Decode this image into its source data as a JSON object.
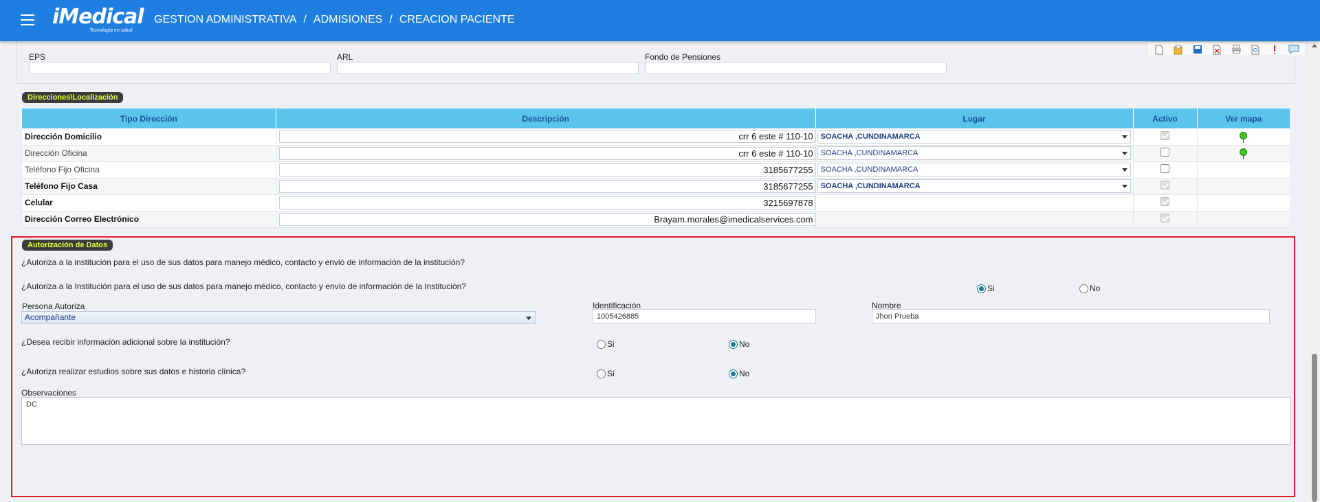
{
  "header": {
    "logo_text": "iMedical",
    "logo_tagline": "Tecnología en salud",
    "breadcrumb": [
      "GESTION ADMINISTRATIVA",
      "/",
      "ADMISIONES",
      "/",
      "CREACION PACIENTE"
    ]
  },
  "affiliation": {
    "eps_label": "EPS",
    "arl_label": "ARL",
    "pension_label": "Fondo de Pensiones",
    "eps_value": "",
    "arl_value": "",
    "pension_value": ""
  },
  "directions": {
    "section_title": "Direcciones\\Localización",
    "columns": [
      "Tipo Dirección",
      "Descripción",
      "Lugar",
      "Activo",
      "Ver mapa"
    ],
    "rows": [
      {
        "type": "Dirección Domicilio",
        "bold": true,
        "description": "crr 6 este # 110-10",
        "place": "SOACHA ,CUNDINAMARCA",
        "place_bold": true,
        "active": true,
        "active_disabled": true,
        "map": true
      },
      {
        "type": "Dirección Oficina",
        "bold": false,
        "description": "crr 6 este # 110-10",
        "place": "SOACHA ,CUNDINAMARCA",
        "place_bold": false,
        "active": false,
        "active_disabled": false,
        "map": true
      },
      {
        "type": "Teléfono Fijo Oficina",
        "bold": false,
        "description": "3185677255",
        "place": "SOACHA ,CUNDINAMARCA",
        "place_bold": false,
        "active": false,
        "active_disabled": false,
        "map": false
      },
      {
        "type": "Teléfono Fijo Casa",
        "bold": true,
        "description": "3185677255",
        "place": "SOACHA ,CUNDINAMARCA",
        "place_bold": true,
        "active": true,
        "active_disabled": true,
        "map": false
      },
      {
        "type": "Celular",
        "bold": true,
        "description": "3215697878",
        "place": "",
        "place_bold": false,
        "active": true,
        "active_disabled": true,
        "map": false
      },
      {
        "type": "Dirección Correo Electrónico",
        "bold": true,
        "description": "Brayam.morales@imedicalservices.com",
        "place": "",
        "place_bold": false,
        "active": true,
        "active_disabled": true,
        "map": false
      }
    ]
  },
  "authorization": {
    "section_title": "Autorización de Datos",
    "q1": "¿Autoriza a la institución para el uso de sus datos para manejo médico, contacto y envió de información de la institución?",
    "q2": "¿Autoriza a la Institución para el uso de sus datos para manejo médico, contacto y envío de información de la Institución?",
    "q2_yes": "Si",
    "q2_no": "No",
    "q2_value": "Si",
    "persona_label": "Persona Autoriza",
    "persona_value": "Acompañante",
    "identificacion_label": "Identificación",
    "identificacion_value": "1005426885",
    "nombre_label": "Nombre",
    "nombre_value": "Jhon Prueba",
    "q3": "¿Desea recibir información adicional sobre la institución?",
    "q3_yes": "Si",
    "q3_no": "No",
    "q3_value": "No",
    "q4": "¿Autoriza realizar estudios sobre sus datos e historia clínica?",
    "q4_yes": "Si",
    "q4_no": "No",
    "q4_value": "No",
    "observaciones_label": "Observaciones",
    "observaciones_value": "DC"
  },
  "toolbar": {
    "icons": [
      "new-document-icon",
      "open-folder-icon",
      "save-icon",
      "delete-icon",
      "print-icon",
      "preview-icon",
      "alert-icon",
      "comment-icon"
    ]
  }
}
